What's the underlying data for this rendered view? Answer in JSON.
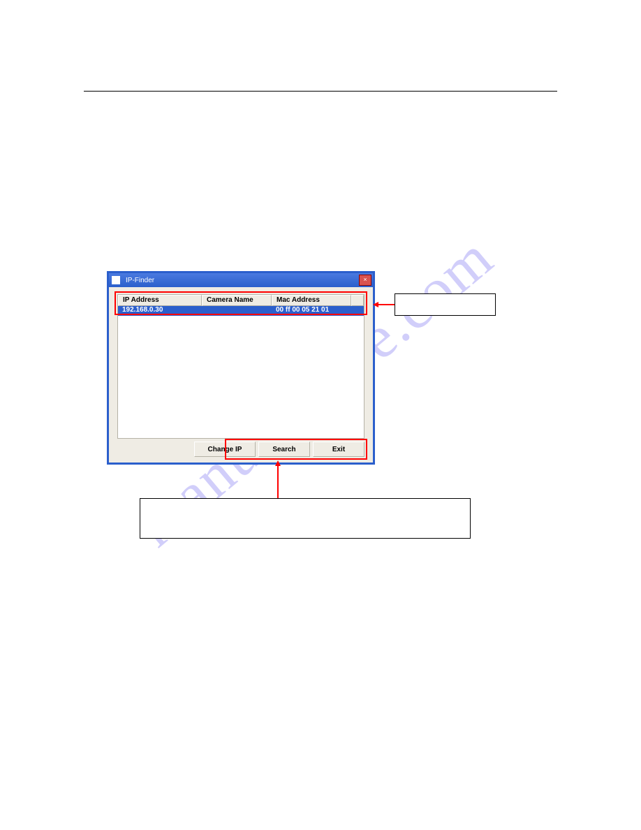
{
  "watermark": "manualshive.com",
  "dialog": {
    "title": "IP-Finder",
    "close_label": "×",
    "columns": {
      "ip": "IP Address",
      "name": "Camera Name",
      "mac": "Mac Address"
    },
    "rows": [
      {
        "ip": "192.168.0.30",
        "name": "",
        "mac": "00 ff 00 05 21 01"
      }
    ],
    "buttons": {
      "change_ip": "Change IP",
      "search": "Search",
      "exit": "Exit"
    }
  },
  "annotations": {
    "right": "",
    "bottom": ""
  }
}
